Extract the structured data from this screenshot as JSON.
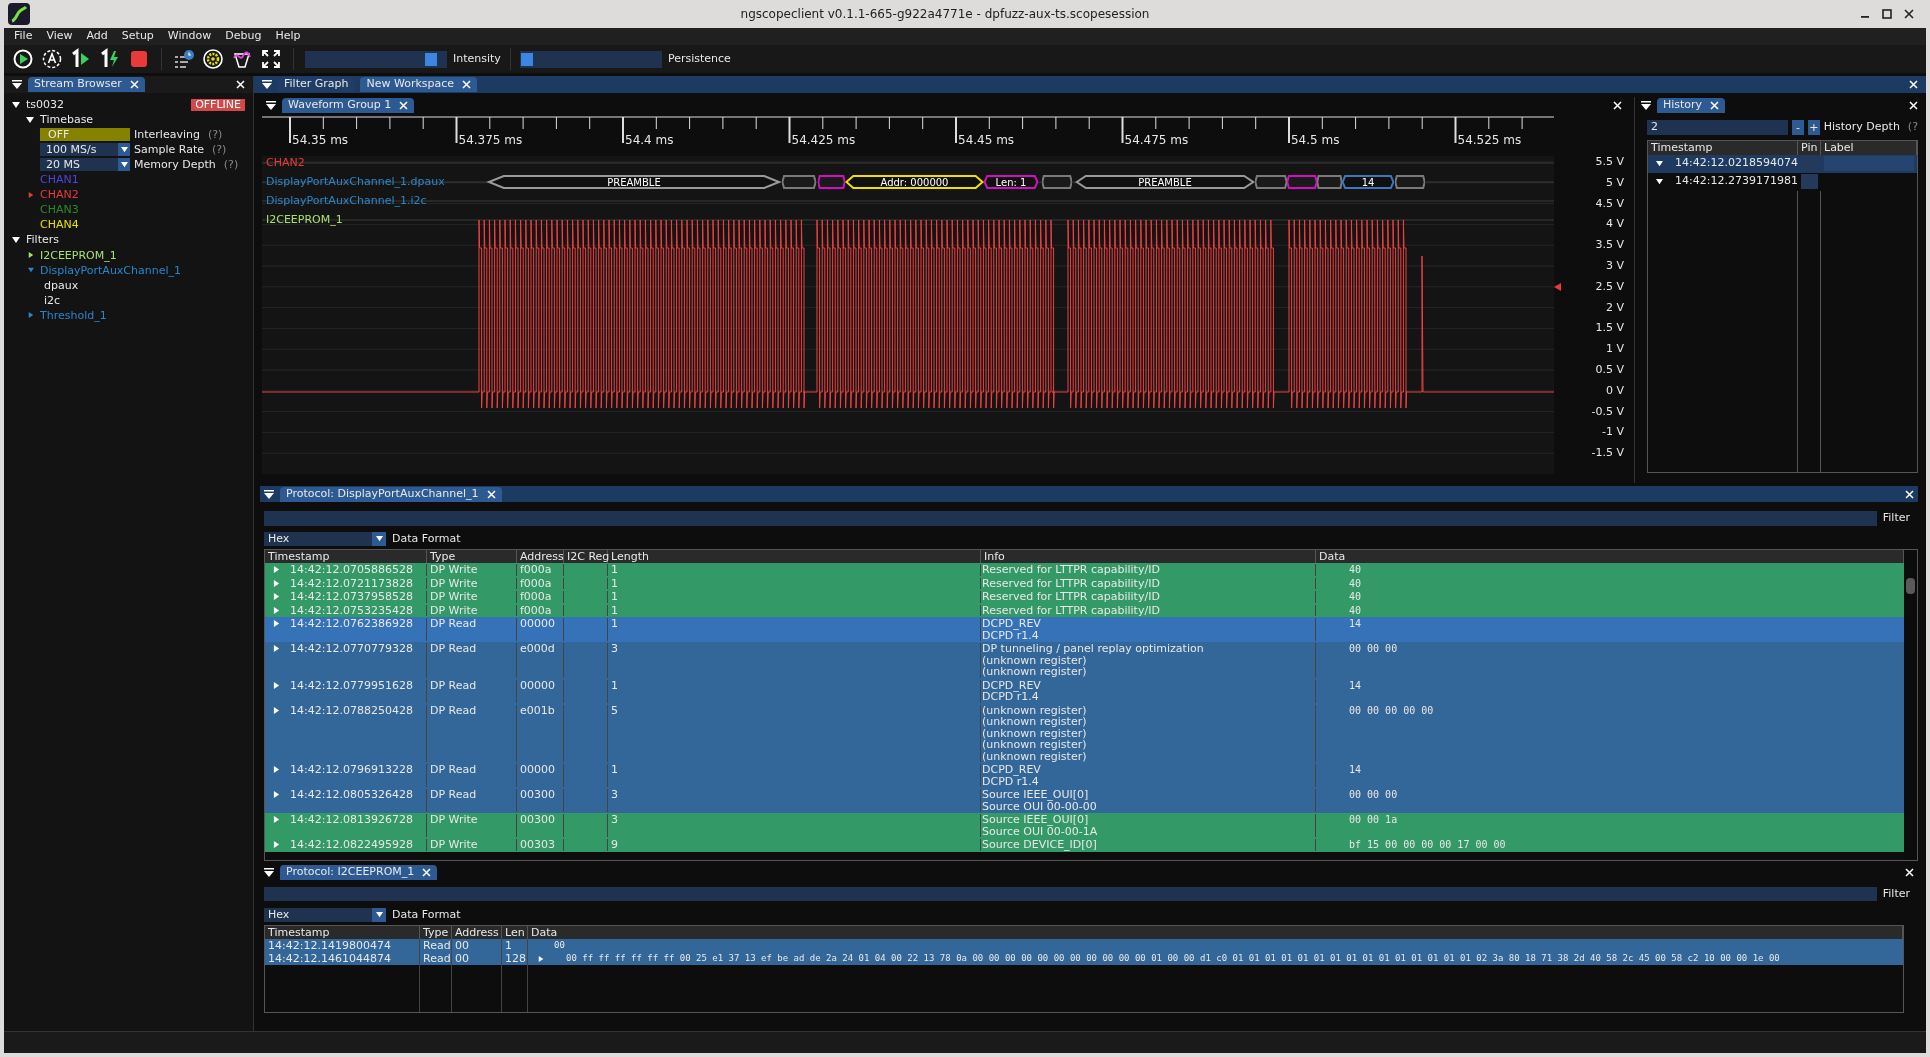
{
  "window": {
    "title": "ngscopeclient v0.1.1-665-g922a4771e - dpfuzz-aux-ts.scopesession"
  },
  "menu": [
    "File",
    "View",
    "Add",
    "Setup",
    "Window",
    "Debug",
    "Help"
  ],
  "sliders": [
    {
      "label": "Intensity",
      "level": 0.93
    },
    {
      "label": "Persistence",
      "level": 0.0
    }
  ],
  "stream_browser": {
    "tab": "Stream Browser",
    "instrument": {
      "name": "ts0032",
      "status": "OFFLINE",
      "expanded": true,
      "timebase": {
        "label": "Timebase",
        "expanded": true,
        "settings": [
          {
            "kind": "toggle",
            "value": "OFF",
            "label": "Interleaving",
            "help": "(?)"
          },
          {
            "kind": "dropdown",
            "value": "100 MS/s",
            "label": "Sample Rate",
            "help": "(?)"
          },
          {
            "kind": "dropdown",
            "value": "20 MS",
            "label": "Memory Depth",
            "help": "(?)"
          }
        ]
      },
      "channels": [
        {
          "name": "CHAN1",
          "color": "#4a46e0",
          "expandable": false
        },
        {
          "name": "CHAN2",
          "color": "#e83a3a",
          "expandable": true
        },
        {
          "name": "CHAN3",
          "color": "#2a8a2a",
          "expandable": false
        },
        {
          "name": "CHAN4",
          "color": "#e8e000",
          "expandable": false
        }
      ]
    },
    "filters": {
      "label": "Filters",
      "expanded": true,
      "items": [
        {
          "name": "I2CEEPROM_1",
          "color": "#a8e070",
          "expanded": false
        },
        {
          "name": "DisplayPortAuxChannel_1",
          "color": "#2a86cc",
          "expanded": true,
          "children": [
            {
              "name": "dpaux"
            },
            {
              "name": "i2c"
            }
          ]
        },
        {
          "name": "Threshold_1",
          "color": "#2a86cc",
          "expanded": false
        }
      ]
    }
  },
  "workspace_tabs": [
    {
      "label": "Filter Graph",
      "selected": false,
      "closable": false
    },
    {
      "label": "New Workspace",
      "selected": true,
      "closable": true
    }
  ],
  "waveform_group": {
    "tab": "Waveform Group 1",
    "time_labels": [
      "54.35 ms",
      "54.375 ms",
      "54.4 ms",
      "54.425 ms",
      "54.45 ms",
      "54.475 ms",
      "54.5 ms",
      "54.525 ms"
    ],
    "traces": [
      {
        "name": "CHAN2",
        "color": "#e83a3a"
      },
      {
        "name": "DisplayPortAuxChannel_1.dpaux",
        "color": "#2a86cc"
      },
      {
        "name": "DisplayPortAuxChannel_1.i2c",
        "color": "#2a86cc"
      },
      {
        "name": "I2CEEPROM_1",
        "color": "#a8e070"
      }
    ],
    "packets": [
      {
        "label": "PREAMBLE",
        "color": "#9a9a9a"
      },
      {
        "color": "#7a7a7a"
      },
      {
        "color": "#d010c0"
      },
      {
        "label": "Addr: 000000",
        "color": "#f0e000"
      },
      {
        "label": "Len: 1",
        "color": "#d010c0"
      },
      {
        "color": "#7a7a7a"
      },
      {
        "label": "PREAMBLE",
        "color": "#9a9a9a"
      },
      {
        "color": "#7a7a7a"
      },
      {
        "color": "#d010c0"
      },
      {
        "color": "#7a7a7a"
      },
      {
        "label": "14",
        "color": "#3a78c0"
      },
      {
        "color": "#7a7a7a"
      }
    ],
    "voltage_labels": [
      "5.5 V",
      "5 V",
      "4.5 V",
      "4 V",
      "3.5 V",
      "3 V",
      "2.5 V",
      "2 V",
      "1.5 V",
      "1 V",
      "0.5 V",
      "0 V",
      "-0.5 V",
      "-1 V",
      "-1.5 V"
    ]
  },
  "history": {
    "tab": "History",
    "depth": "2",
    "minus": "-",
    "plus": "+",
    "depth_label": "History Depth",
    "help": "(?",
    "columns": [
      "Timestamp",
      "Pin",
      "Label"
    ],
    "rows": [
      {
        "timestamp": "14:42:12.0218594074",
        "selected": true
      },
      {
        "timestamp": "14:42:12.2739171981",
        "selected": false
      }
    ]
  },
  "dp_protocol": {
    "tab": "Protocol: DisplayPortAuxChannel_1",
    "filter_label": "Filter",
    "format": "Hex",
    "format_label": "Data Format",
    "columns": [
      "Timestamp",
      "Type",
      "Address",
      "I2C Reg",
      "Length",
      "Info",
      "Data"
    ],
    "rows": [
      {
        "kind": "write",
        "selected": false,
        "timestamp": "14:42:12.0705886528",
        "type": "DP Write",
        "address": "f000a",
        "length": "1",
        "info": [
          "Reserved for LTTPR capability/ID"
        ],
        "data": "40"
      },
      {
        "kind": "write",
        "selected": false,
        "timestamp": "14:42:12.0721173828",
        "type": "DP Write",
        "address": "f000a",
        "length": "1",
        "info": [
          "Reserved for LTTPR capability/ID"
        ],
        "data": "40"
      },
      {
        "kind": "write",
        "selected": false,
        "timestamp": "14:42:12.0737958528",
        "type": "DP Write",
        "address": "f000a",
        "length": "1",
        "info": [
          "Reserved for LTTPR capability/ID"
        ],
        "data": "40"
      },
      {
        "kind": "write",
        "selected": false,
        "timestamp": "14:42:12.0753235428",
        "type": "DP Write",
        "address": "f000a",
        "length": "1",
        "info": [
          "Reserved for LTTPR capability/ID"
        ],
        "data": "40"
      },
      {
        "kind": "read",
        "selected": true,
        "timestamp": "14:42:12.0762386928",
        "type": "DP Read",
        "address": "00000",
        "length": "1",
        "info": [
          "DCPD_REV",
          "DCPD r1.4"
        ],
        "data": "14"
      },
      {
        "kind": "read",
        "selected": false,
        "timestamp": "14:42:12.0770779328",
        "type": "DP Read",
        "address": "e000d",
        "length": "3",
        "info": [
          "DP tunneling / panel replay optimization",
          "(unknown register)",
          "(unknown register)"
        ],
        "data": "00 00 00"
      },
      {
        "kind": "read",
        "selected": false,
        "timestamp": "14:42:12.0779951628",
        "type": "DP Read",
        "address": "00000",
        "length": "1",
        "info": [
          "DCPD_REV",
          "DCPD r1.4"
        ],
        "data": "14"
      },
      {
        "kind": "read",
        "selected": false,
        "timestamp": "14:42:12.0788250428",
        "type": "DP Read",
        "address": "e001b",
        "length": "5",
        "info": [
          "(unknown register)",
          "(unknown register)",
          "(unknown register)",
          "(unknown register)",
          "(unknown register)"
        ],
        "data": "00 00 00 00 00"
      },
      {
        "kind": "read",
        "selected": false,
        "timestamp": "14:42:12.0796913228",
        "type": "DP Read",
        "address": "00000",
        "length": "1",
        "info": [
          "DCPD_REV",
          "DCPD r1.4"
        ],
        "data": "14"
      },
      {
        "kind": "read",
        "selected": false,
        "timestamp": "14:42:12.0805326428",
        "type": "DP Read",
        "address": "00300",
        "length": "3",
        "info": [
          "Source IEEE_OUI[0]",
          "Source OUI 00-00-00"
        ],
        "data": "00 00 00"
      },
      {
        "kind": "write",
        "selected": false,
        "timestamp": "14:42:12.0813926728",
        "type": "DP Write",
        "address": "00300",
        "length": "3",
        "info": [
          "Source IEEE_OUI[0]",
          "Source OUI 00-00-1A"
        ],
        "data": "00 00 1a"
      },
      {
        "kind": "write",
        "selected": false,
        "timestamp": "14:42:12.0822495928",
        "type": "DP Write",
        "address": "00303",
        "length": "9",
        "info": [
          "Source DEVICE_ID[0]"
        ],
        "data": "bf 15 00 00 00 00 17 00 00"
      }
    ]
  },
  "i2c_protocol": {
    "tab": "Protocol: I2CEEPROM_1",
    "filter_label": "Filter",
    "format": "Hex",
    "format_label": "Data Format",
    "columns": [
      "Timestamp",
      "Type",
      "Address",
      "Len",
      "Data"
    ],
    "rows": [
      {
        "kind": "read",
        "expandable": false,
        "timestamp": "14:42:12.1419800474",
        "type": "Read",
        "address": "00",
        "len": "1",
        "data": "00"
      },
      {
        "kind": "read",
        "expandable": true,
        "timestamp": "14:42:12.1461044874",
        "type": "Read",
        "address": "00",
        "len": "128",
        "data": "00 ff ff ff ff ff ff 00 25 e1 37 13 ef be ad de 2a 24 01 04 00 22 13 78 0a 00 00 00 00 00 00 00 00 00 00 00 01 00 00 d1 c0 01 01 01 01 01 01 01 01 01 01 01 01 01 01 01 02 3a 80 18 71 38 2d 40 58 2c 45 00 58 c2 10 00 00 1e 00"
      }
    ]
  }
}
